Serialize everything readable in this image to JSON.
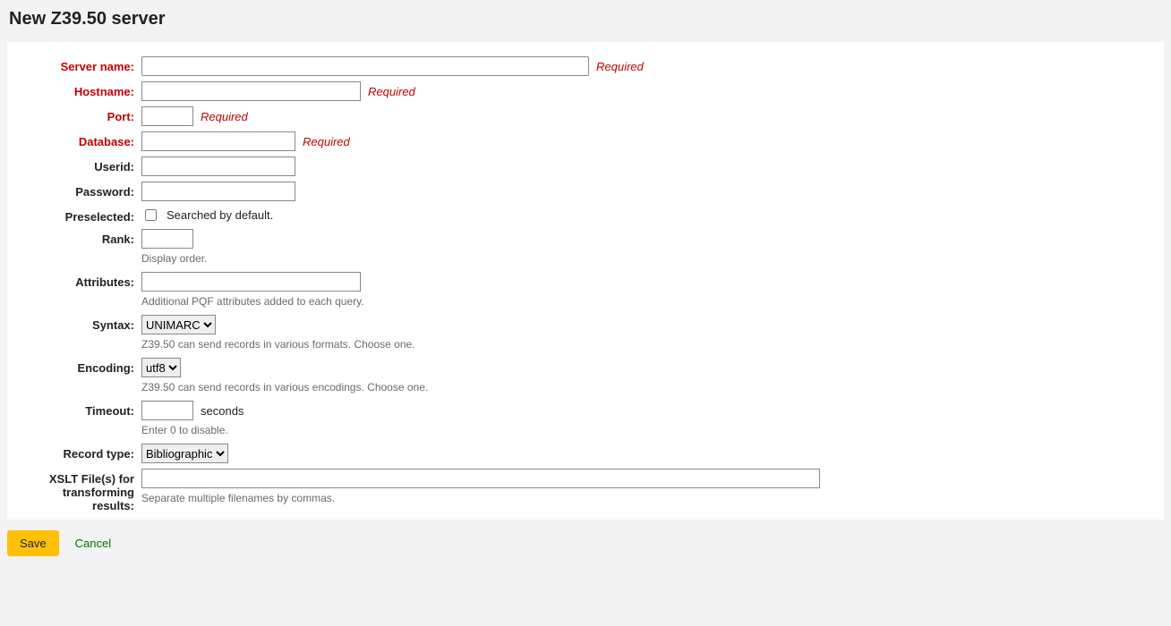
{
  "page": {
    "title": "New Z39.50 server"
  },
  "labels": {
    "server_name": "Server name:",
    "hostname": "Hostname:",
    "port": "Port:",
    "database": "Database:",
    "userid": "Userid:",
    "password": "Password:",
    "preselected": "Preselected:",
    "rank": "Rank:",
    "attributes": "Attributes:",
    "syntax": "Syntax:",
    "encoding": "Encoding:",
    "timeout": "Timeout:",
    "record_type": "Record type:",
    "xslt": "XSLT File(s) for transforming results:"
  },
  "required_tag": "Required",
  "checkbox": {
    "searched_by_default": "Searched by default."
  },
  "hints": {
    "rank": "Display order.",
    "attributes": "Additional PQF attributes added to each query.",
    "syntax": "Z39.50 can send records in various formats. Choose one.",
    "encoding": "Z39.50 can send records in various encodings. Choose one.",
    "timeout": "Enter 0 to disable.",
    "xslt": "Separate multiple filenames by commas."
  },
  "units": {
    "seconds": "seconds"
  },
  "selects": {
    "syntax": {
      "value": "UNIMARC"
    },
    "encoding": {
      "value": "utf8"
    },
    "record_type": {
      "value": "Bibliographic"
    }
  },
  "actions": {
    "save": "Save",
    "cancel": "Cancel"
  }
}
